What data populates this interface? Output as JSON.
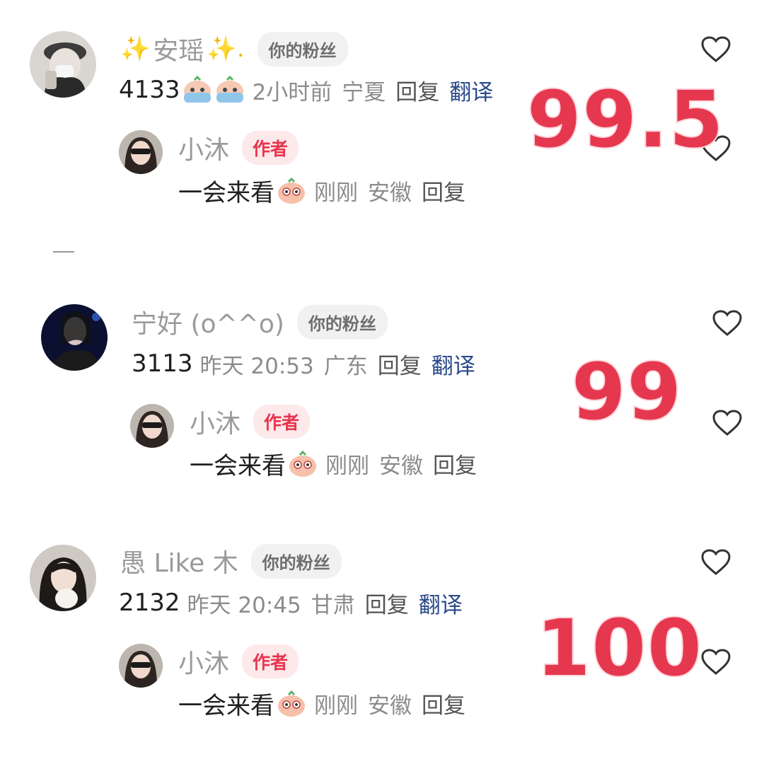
{
  "comments": [
    {
      "user": {
        "prefix": "✨",
        "name": "安瑶",
        "suffix": "✨.",
        "badge": "你的粉丝"
      },
      "text": "4133",
      "time": "2小时前",
      "region": "宁夏",
      "reply_label": "回复",
      "translate_label": "翻译",
      "author_reply": {
        "name": "小沐",
        "badge": "作者",
        "text": "一会来看",
        "time": "刚刚",
        "region": "安徽",
        "reply_label": "回复"
      },
      "score": "99.5"
    },
    {
      "user": {
        "name": "宁好 (o^^o)",
        "badge": "你的粉丝"
      },
      "text": "3113",
      "time": "昨天 20:53",
      "region": "广东",
      "reply_label": "回复",
      "translate_label": "翻译",
      "author_reply": {
        "name": "小沐",
        "badge": "作者",
        "text": "一会来看",
        "time": "刚刚",
        "region": "安徽",
        "reply_label": "回复"
      },
      "score": "99"
    },
    {
      "user": {
        "name": "愚 Like 木",
        "badge": "你的粉丝"
      },
      "text": "2132",
      "time": "昨天 20:45",
      "region": "甘肃",
      "reply_label": "回复",
      "translate_label": "翻译",
      "author_reply": {
        "name": "小沐",
        "badge": "作者",
        "text": "一会来看",
        "time": "刚刚",
        "region": "安徽",
        "reply_label": "回复"
      },
      "score": "100"
    }
  ],
  "colors": {
    "score": "#e5384f",
    "translate": "#2b4a8a",
    "author_badge": "#e8344e"
  },
  "icons": [
    "heart-outline-icon",
    "crying-emoji-icon",
    "peeking-emoji-icon",
    "sparkle-icon"
  ]
}
